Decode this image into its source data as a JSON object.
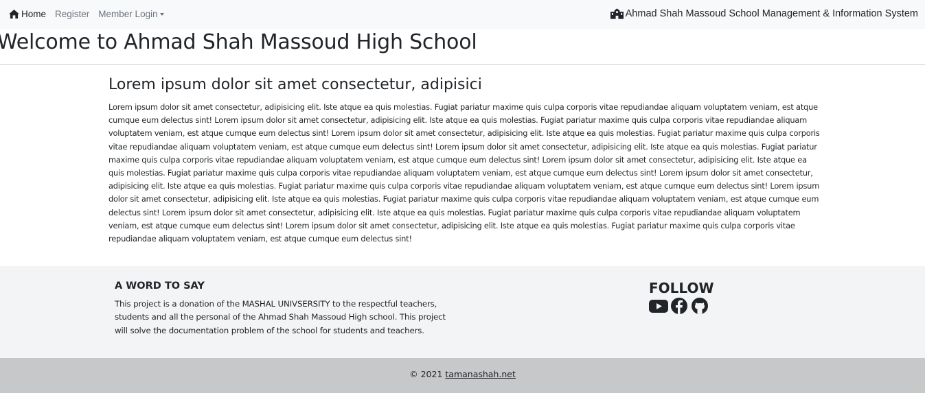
{
  "navbar": {
    "home_label": "Home",
    "register_label": "Register",
    "member_login_label": "Member Login",
    "brand": "Ahmad Shah Massoud School Management & Information System"
  },
  "hero": {
    "title": "Welcome to Ahmad Shah Massoud High School"
  },
  "article": {
    "title": "Lorem ipsum dolor sit amet consectetur, adipisici",
    "body": "Lorem ipsum dolor sit amet consectetur, adipisicing elit. Iste atque ea quis molestias. Fugiat pariatur maxime quis culpa corporis vitae repudiandae aliquam voluptatem veniam, est atque cumque eum delectus sint! Lorem ipsum dolor sit amet consectetur, adipisicing elit. Iste atque ea quis molestias. Fugiat pariatur maxime quis culpa corporis vitae repudiandae aliquam voluptatem veniam, est atque cumque eum delectus sint! Lorem ipsum dolor sit amet consectetur, adipisicing elit. Iste atque ea quis molestias. Fugiat pariatur maxime quis culpa corporis vitae repudiandae aliquam voluptatem veniam, est atque cumque eum delectus sint! Lorem ipsum dolor sit amet consectetur, adipisicing elit. Iste atque ea quis molestias. Fugiat pariatur maxime quis culpa corporis vitae repudiandae aliquam voluptatem veniam, est atque cumque eum delectus sint! Lorem ipsum dolor sit amet consectetur, adipisicing elit. Iste atque ea quis molestias. Fugiat pariatur maxime quis culpa corporis vitae repudiandae aliquam voluptatem veniam, est atque cumque eum delectus sint! Lorem ipsum dolor sit amet consectetur, adipisicing elit. Iste atque ea quis molestias. Fugiat pariatur maxime quis culpa corporis vitae repudiandae aliquam voluptatem veniam, est atque cumque eum delectus sint! Lorem ipsum dolor sit amet consectetur, adipisicing elit. Iste atque ea quis molestias. Fugiat pariatur maxime quis culpa corporis vitae repudiandae aliquam voluptatem veniam, est atque cumque eum delectus sint! Lorem ipsum dolor sit amet consectetur, adipisicing elit. Iste atque ea quis molestias. Fugiat pariatur maxime quis culpa corporis vitae repudiandae aliquam voluptatem veniam, est atque cumque eum delectus sint! Lorem ipsum dolor sit amet consectetur, adipisicing elit. Iste atque ea quis molestias. Fugiat pariatur maxime quis culpa corporis vitae repudiandae aliquam voluptatem veniam, est atque cumque eum delectus sint!"
  },
  "footer": {
    "word_title": "A WORD TO SAY",
    "word_text": "This project is a donation of the MASHAL UNIVSERSITY to the respectful teachers, students and all the personal of the Ahmad Shah Massoud High school. This project will solve the documentation problem of the school for students and teachers.",
    "follow_title": "FOLLOW",
    "social_icons": [
      "youtube-icon",
      "facebook-icon",
      "github-icon"
    ]
  },
  "copyright": {
    "prefix": "© 2021",
    "link_text": "tamanashah.net"
  },
  "colors": {
    "navbar_bg": "#f8f9fa",
    "footer_bg": "#f3f4f5",
    "copyright_bg": "#c6c8ca",
    "muted_link": "#6c757d",
    "text": "#212529"
  }
}
